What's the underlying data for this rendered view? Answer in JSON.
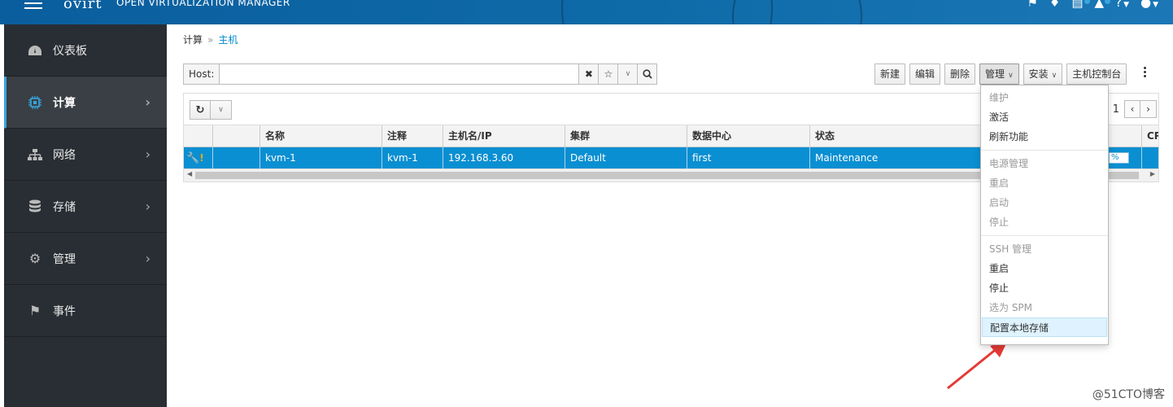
{
  "topbar": {
    "brand": "ovirt",
    "subtitle": "OPEN VIRTUALIZATION MANAGER"
  },
  "sidebar": {
    "items": [
      {
        "label": "仪表板",
        "icon": "dashboard-icon",
        "active": false
      },
      {
        "label": "计算",
        "icon": "cpu-icon",
        "active": true
      },
      {
        "label": "网络",
        "icon": "network-icon",
        "active": false
      },
      {
        "label": "存储",
        "icon": "database-icon",
        "active": false
      },
      {
        "label": "管理",
        "icon": "gear-icon",
        "active": false
      },
      {
        "label": "事件",
        "icon": "flag-icon",
        "active": false
      }
    ]
  },
  "breadcrumb": {
    "parent": "计算",
    "separator": "»",
    "current": "主机"
  },
  "search": {
    "label": "Host:",
    "value": ""
  },
  "actions": {
    "new": "新建",
    "edit": "编辑",
    "delete": "删除",
    "manage": "管理",
    "install": "安装",
    "console": "主机控制台"
  },
  "pager": {
    "page": "1"
  },
  "table": {
    "columns": [
      "名称",
      "注释",
      "主机名/IP",
      "集群",
      "数据中心",
      "状态",
      "CP"
    ],
    "rows": [
      {
        "name": "kvm-1",
        "comment": "kvm-1",
        "host": "192.168.3.60",
        "cluster": "Default",
        "datacenter": "first",
        "status": "Maintenance",
        "usage": "%"
      }
    ]
  },
  "dropdown": {
    "groups": [
      [
        {
          "label": "维护",
          "disabled": true
        },
        {
          "label": "激活",
          "disabled": false
        },
        {
          "label": "刷新功能",
          "disabled": false
        }
      ],
      [
        {
          "label": "电源管理",
          "disabled": true
        },
        {
          "label": "重启",
          "disabled": true
        },
        {
          "label": "启动",
          "disabled": true
        },
        {
          "label": "停止",
          "disabled": true
        }
      ],
      [
        {
          "label": "SSH 管理",
          "disabled": true
        },
        {
          "label": "重启",
          "disabled": false
        },
        {
          "label": "停止",
          "disabled": false
        },
        {
          "label": "选为 SPM",
          "disabled": true
        },
        {
          "label": "配置本地存储",
          "disabled": false,
          "highlighted": true
        }
      ]
    ]
  },
  "watermark": "@51CTO博客",
  "colors": {
    "accent": "#0088ce",
    "selected_row": "#0a8fd2",
    "sidebar": "#292e34",
    "arrow": "#e53935"
  }
}
